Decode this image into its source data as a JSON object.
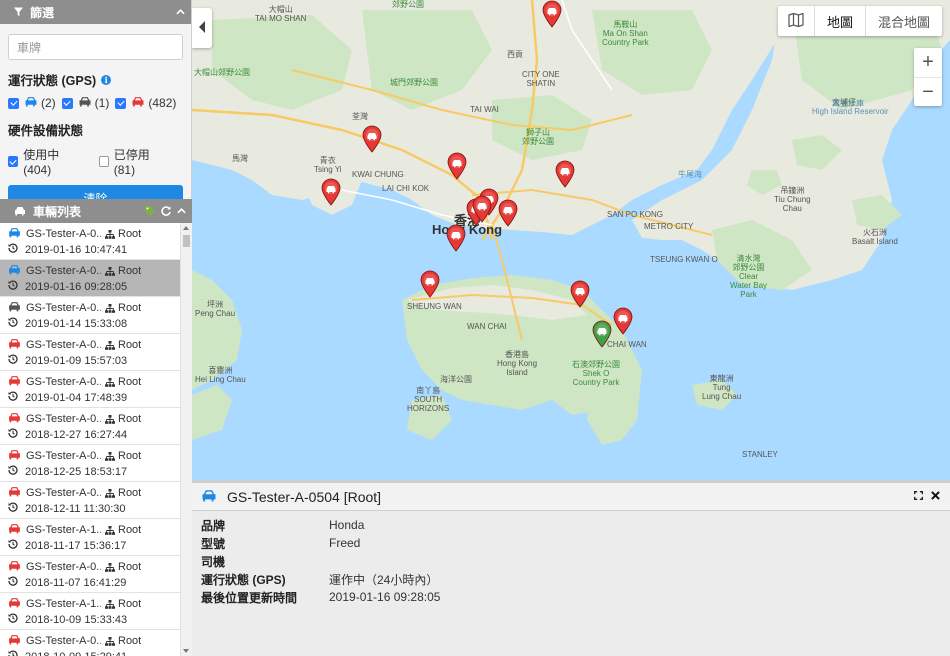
{
  "filter": {
    "title": "篩選",
    "search_placeholder": "車牌",
    "gps_label": "運行狀態 (GPS)",
    "gps_items": [
      {
        "count": "(2)",
        "color": "#1e88e5"
      },
      {
        "count": "(1)",
        "color": "#555555"
      },
      {
        "count": "(482)",
        "color": "#e53935"
      }
    ],
    "hw_label": "硬件設備狀態",
    "hw_items": [
      {
        "label": "使用中 (404)",
        "checked": true
      },
      {
        "label": "已停用 (81)",
        "checked": false
      }
    ],
    "clear_label": "清除"
  },
  "vehicles_panel": {
    "title": "車輛列表",
    "items": [
      {
        "name": "GS-Tester-A-0...",
        "org": "Root",
        "time": "2019-01-16 10:47:41",
        "color": "#1e88e5",
        "selected": false
      },
      {
        "name": "GS-Tester-A-0...",
        "org": "Root",
        "time": "2019-01-16 09:28:05",
        "color": "#1e88e5",
        "selected": true
      },
      {
        "name": "GS-Tester-A-0...",
        "org": "Root",
        "time": "2019-01-14 15:33:08",
        "color": "#555555",
        "selected": false
      },
      {
        "name": "GS-Tester-A-0...",
        "org": "Root",
        "time": "2019-01-09 15:57:03",
        "color": "#e53935",
        "selected": false
      },
      {
        "name": "GS-Tester-A-0...",
        "org": "Root",
        "time": "2019-01-04 17:48:39",
        "color": "#e53935",
        "selected": false
      },
      {
        "name": "GS-Tester-A-0...",
        "org": "Root",
        "time": "2018-12-27 16:27:44",
        "color": "#e53935",
        "selected": false
      },
      {
        "name": "GS-Tester-A-0...",
        "org": "Root",
        "time": "2018-12-25 18:53:17",
        "color": "#e53935",
        "selected": false
      },
      {
        "name": "GS-Tester-A-0...",
        "org": "Root",
        "time": "2018-12-11 11:30:30",
        "color": "#e53935",
        "selected": false
      },
      {
        "name": "GS-Tester-A-1...",
        "org": "Root",
        "time": "2018-11-17 15:36:17",
        "color": "#e53935",
        "selected": false
      },
      {
        "name": "GS-Tester-A-0...",
        "org": "Root",
        "time": "2018-11-07 16:41:29",
        "color": "#e53935",
        "selected": false
      },
      {
        "name": "GS-Tester-A-1...",
        "org": "Root",
        "time": "2018-10-09 15:33:43",
        "color": "#e53935",
        "selected": false
      },
      {
        "name": "GS-Tester-A-0...",
        "org": "Root",
        "time": "2018-10-09 15:29:41",
        "color": "#e53935",
        "selected": false
      }
    ]
  },
  "map": {
    "type_buttons": {
      "map": "地圖",
      "hybrid": "混合地圖"
    },
    "zoom_in": "+",
    "zoom_out": "−",
    "labels": [
      {
        "text": "大帽山\nTAI MO SHAN",
        "cls": ""
      },
      {
        "text": "大帽山郊野公園",
        "cls": "green"
      },
      {
        "text": "城門郊野公園",
        "cls": "green"
      },
      {
        "text": "郊野公園",
        "cls": "green"
      },
      {
        "text": "馬鞍山\nMa On Shan\nCountry Park",
        "cls": "green"
      },
      {
        "text": "西貢",
        "cls": ""
      },
      {
        "text": "大埔仔",
        "cls": ""
      },
      {
        "text": "High Island Reservoir",
        "cls": "water"
      },
      {
        "text": "萬宜水庫",
        "cls": "water"
      },
      {
        "text": "滘西洲\nKau Sai Chau",
        "cls": ""
      },
      {
        "text": "荃灣",
        "cls": ""
      },
      {
        "text": "馬灣",
        "cls": ""
      },
      {
        "text": "青衣\nTsing Yi",
        "cls": ""
      },
      {
        "text": "獅子山\n郊野公園",
        "cls": "green"
      },
      {
        "text": "牛尾海",
        "cls": "water"
      },
      {
        "text": "吊鐘洲\nTiu Chung\nChau",
        "cls": ""
      },
      {
        "text": "香港\nHong Kong",
        "cls": "big"
      },
      {
        "text": "清水灣\n郊野公園\nClear\nWater Bay\nPark",
        "cls": "green"
      },
      {
        "text": "火石洲\nBasalt Island",
        "cls": ""
      },
      {
        "text": "坪洲\nPeng Chau",
        "cls": ""
      },
      {
        "text": "香港島\nHong Kong\nIsland",
        "cls": ""
      },
      {
        "text": "石澳郊野公園\nShek O\nCountry Park",
        "cls": "green"
      },
      {
        "text": "喜靈洲\nHei Ling Chau",
        "cls": ""
      },
      {
        "text": "海洋公園",
        "cls": ""
      },
      {
        "text": "南丫島\nSOUTH\nHORIZONS",
        "cls": ""
      },
      {
        "text": "東龍洲\nTung\nLung Chau",
        "cls": ""
      },
      {
        "text": "STANLEY",
        "cls": ""
      },
      {
        "text": "CHAI WAN",
        "cls": ""
      },
      {
        "text": "WAN CHAI",
        "cls": ""
      },
      {
        "text": "SHEUNG WAN",
        "cls": ""
      },
      {
        "text": "METRO CITY",
        "cls": ""
      },
      {
        "text": "TSEUNG KWAN O",
        "cls": ""
      },
      {
        "text": "SAN PO KONG",
        "cls": ""
      },
      {
        "text": "CITY ONE\nSHATIN",
        "cls": ""
      },
      {
        "text": "TAI WAI",
        "cls": ""
      },
      {
        "text": "KWAI CHUNG",
        "cls": ""
      },
      {
        "text": "LAI CHI KOK",
        "cls": ""
      }
    ],
    "pins": [
      {
        "color": "#e53935"
      },
      {
        "color": "#e53935"
      },
      {
        "color": "#e53935"
      },
      {
        "color": "#e53935"
      },
      {
        "color": "#e53935"
      },
      {
        "color": "#e53935"
      },
      {
        "color": "#e53935"
      },
      {
        "color": "#e53935"
      },
      {
        "color": "#e53935"
      },
      {
        "color": "#e53935"
      },
      {
        "color": "#e53935"
      },
      {
        "color": "#e53935"
      },
      {
        "color": "#e53935"
      },
      {
        "color": "#43a047"
      }
    ]
  },
  "info": {
    "title": "GS-Tester-A-0504 [Root]",
    "rows": [
      {
        "key": "品牌",
        "value": "Honda"
      },
      {
        "key": "型號",
        "value": "Freed"
      },
      {
        "key": "司機",
        "value": ""
      },
      {
        "key": "運行狀態 (GPS)",
        "value": "運作中（24小時內）"
      },
      {
        "key": "最後位置更新時間",
        "value": "2019-01-16 09:28:05"
      }
    ]
  }
}
